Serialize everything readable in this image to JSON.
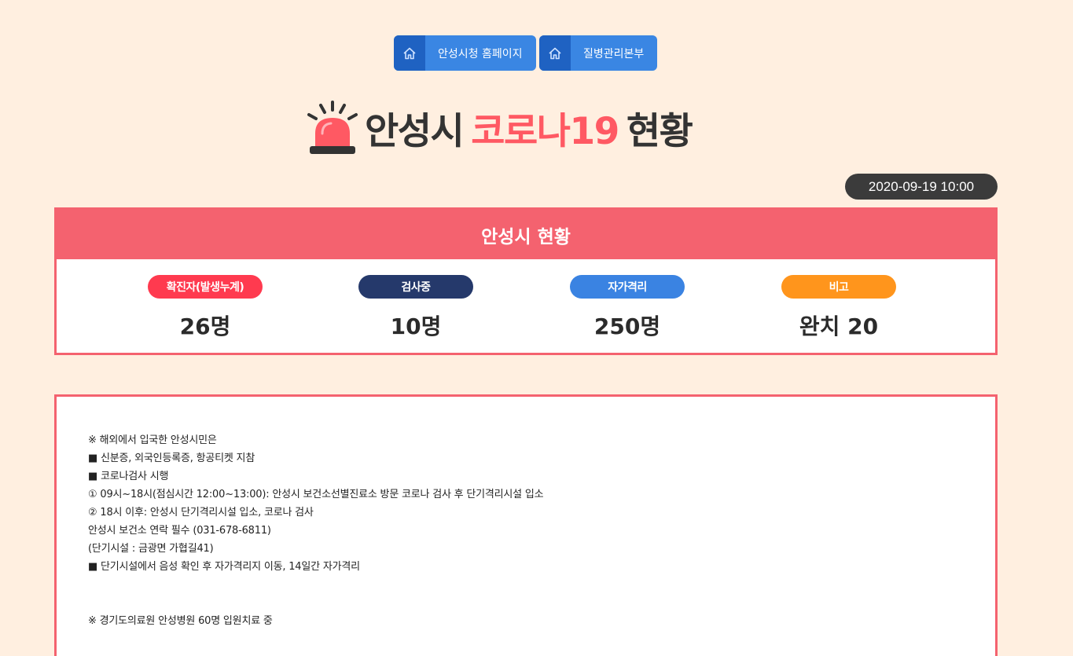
{
  "nav": {
    "links": [
      {
        "label": "안성시청 홈페이지",
        "icon": "home-icon"
      },
      {
        "label": "질병관리본부",
        "icon": "home-icon"
      }
    ]
  },
  "header": {
    "icon": "siren-icon",
    "title_part1": "안성시",
    "title_accent": "코로나19",
    "title_part2": "현황"
  },
  "timestamp": "2020-09-19 10:00",
  "status": {
    "title": "안성시 현황",
    "items": [
      {
        "label": "확진자(발생누계)",
        "value": "26명",
        "color": "#ff3a4f"
      },
      {
        "label": "검사중",
        "value": "10명",
        "color": "#25396b"
      },
      {
        "label": "자가격리",
        "value": "250명",
        "color": "#3a83e2"
      },
      {
        "label": "비고",
        "value": "완치 20",
        "color": "#ff951c"
      }
    ]
  },
  "notice": {
    "lines": [
      "※ 해외에서 입국한 안성시민은",
      "■ 신분증, 외국인등록증, 항공티켓 지참",
      "■ 코로나검사 시행",
      "① 09시~18시(점심시간 12:00~13:00): 안성시 보건소선별진료소 방문 코로나 검사 후 단기격리시설 입소",
      "② 18시 이후: 안성시 단기격리시설 입소, 코로나 검사",
      "안성시 보건소 연락 필수 (031-678-6811)",
      "(단기시설 : 금광면 가협길41)",
      "■ 단기시설에서 음성 확인 후 자가격리지 이동, 14일간 자가격리"
    ],
    "footer": "※ 경기도의료원 안성병원 60명 입원치료 중"
  },
  "colors": {
    "background": "#ffefe0",
    "accent": "#f4626f",
    "nav": "#3a86e3"
  }
}
